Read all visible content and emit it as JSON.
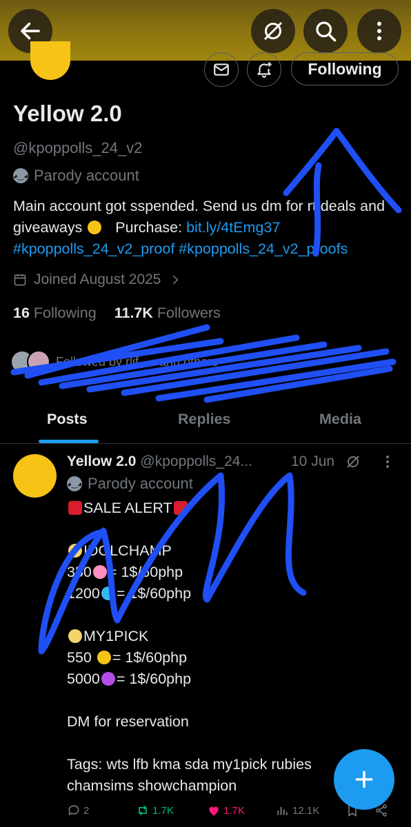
{
  "header": {
    "back_icon": "arrow-left-icon",
    "icons": [
      "grok-icon",
      "search-icon",
      "more-vertical-icon"
    ]
  },
  "actions": {
    "message_icon": "mail-icon",
    "notify_icon": "bell-plus-icon",
    "follow_label": "Following"
  },
  "profile": {
    "name": "Yellow 2.0",
    "handle": "@kpoppolls_24_v2",
    "label": "Parody account",
    "bio_text": "Main account got sspended. Send us dm for rt deals and giveaways",
    "bio_purchase": "Purchase:",
    "bio_link": "bit.ly/4tEmg37",
    "bio_tags": "#kpoppolls_24_v2_proof #kpoppolls_24_v2_proofs",
    "joined": "Joined August 2025",
    "following_count": "16",
    "following_label": "Following",
    "followers_count": "11.7K",
    "followers_label": "Followers",
    "followed_by": "Followed by rlif, ... and others"
  },
  "tabs": [
    "Posts",
    "Replies",
    "Media"
  ],
  "post": {
    "name": "Yellow 2.0",
    "handle": "@kpoppolls_24...",
    "date": "10 Jun",
    "label": "Parody account",
    "lines": [
      "SALE ALERT",
      "",
      "IDOLCHAMP",
      "350",
      "= 1$/60php",
      "1200",
      "= 1$/60php",
      "",
      "MY1PICK",
      "550",
      "= 1$/60php",
      "5000",
      "= 1$/60php",
      "",
      "DM for reservation",
      "",
      "Tags: wts lfb kma sda my1pick rubies",
      "chamsims showchampion"
    ],
    "replies": "2",
    "reposts": "1.7K",
    "likes": "1.7K",
    "views": "12.1K"
  },
  "colors": {
    "accent": "#1d9bf0",
    "header": "#8e7610",
    "avatar": "#f7c317",
    "repost": "#00ba7c",
    "like": "#f91880",
    "scribble": "#1f4ff5"
  }
}
